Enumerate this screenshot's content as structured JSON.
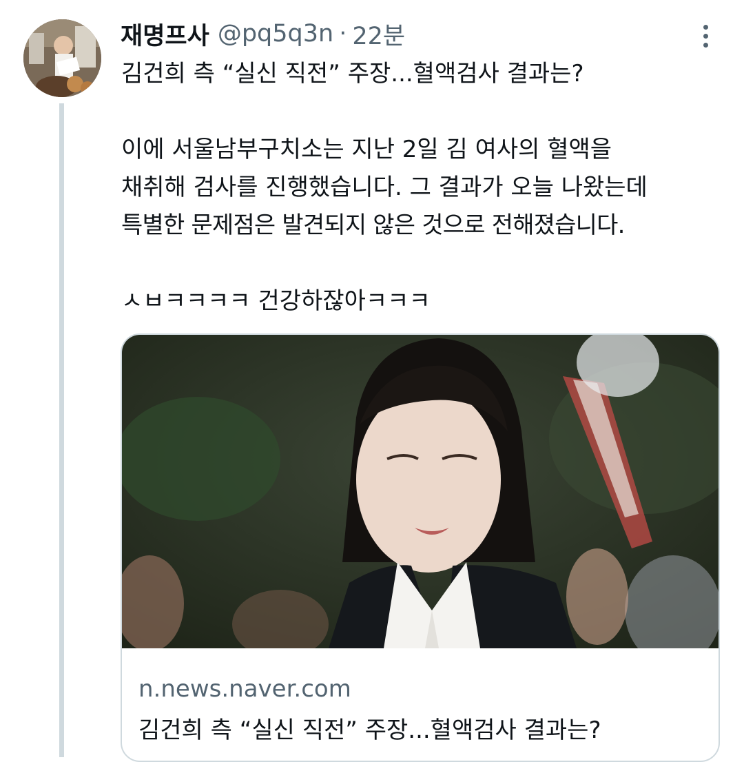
{
  "tweet": {
    "author": {
      "display_name": "재명프사",
      "handle": "@pq5q3n"
    },
    "separator": "·",
    "time": "22분",
    "text": {
      "line1": "김건희 측 “실신 직전” 주장...혈액검사 결과는?",
      "para2_line1": "이에 서울남부구치소는 지난 2일 김 여사의 혈액을",
      "para2_line2": "채취해 검사를 진행했습니다. 그 결과가 오늘 나왔는데",
      "para2_line3": "특별한 문제점은 발견되지 않은 것으로 전해졌습니다.",
      "para3": "ㅅㅂㅋㅋㅋㅋ 건강하잖아ㅋㅋㅋ"
    },
    "link_card": {
      "domain": "n.news.naver.com",
      "title": "김건희 측 “실신 직전” 주장...혈액검사 결과는?"
    }
  },
  "icons": {
    "more": "more-vertical-icon",
    "avatar": "avatar-photo"
  },
  "colors": {
    "text": "#0f1419",
    "secondary": "#536471",
    "border": "#cfd9de",
    "background": "#ffffff"
  }
}
